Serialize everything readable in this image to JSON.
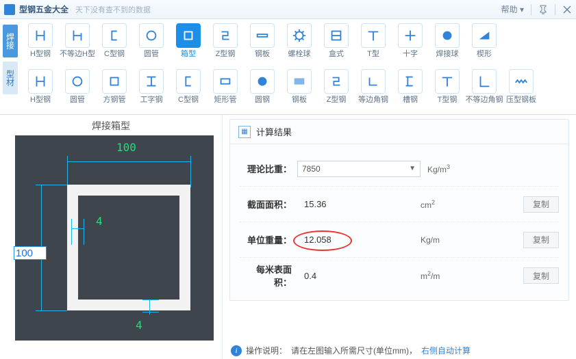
{
  "titlebar": {
    "title": "型钢五金大全",
    "subtitle": "天下没有查不到的数据",
    "help": "帮助",
    "help_arrow": "▾"
  },
  "side_tabs": {
    "weld": "焊接",
    "profile": "型材"
  },
  "row1": [
    {
      "name": "h-steel",
      "label": "H型钢"
    },
    {
      "name": "uneq-h",
      "label": "不等边H型"
    },
    {
      "name": "c-steel",
      "label": "C型钢"
    },
    {
      "name": "round-tube",
      "label": "圆管"
    },
    {
      "name": "box",
      "label": "箱型",
      "selected": true
    },
    {
      "name": "z-steel",
      "label": "Z型钢"
    },
    {
      "name": "plate",
      "label": "钢板"
    },
    {
      "name": "bolt-ball",
      "label": "螺栓球"
    },
    {
      "name": "box-style",
      "label": "盒式"
    },
    {
      "name": "t-type",
      "label": "T型"
    },
    {
      "name": "cross",
      "label": "十字"
    },
    {
      "name": "weld-ball",
      "label": "焊接球"
    },
    {
      "name": "wedge",
      "label": "楔形"
    }
  ],
  "row2": [
    {
      "name": "h-steel2",
      "label": "H型钢"
    },
    {
      "name": "round-tube2",
      "label": "圆管"
    },
    {
      "name": "sq-tube",
      "label": "方钢管"
    },
    {
      "name": "i-steel",
      "label": "工字钢"
    },
    {
      "name": "c-steel2",
      "label": "C型钢"
    },
    {
      "name": "rect-tube",
      "label": "矩形管"
    },
    {
      "name": "round-steel",
      "label": "圆钢"
    },
    {
      "name": "plate2",
      "label": "钢板"
    },
    {
      "name": "z-steel2",
      "label": "Z型钢"
    },
    {
      "name": "eq-angle",
      "label": "等边角钢"
    },
    {
      "name": "channel",
      "label": "槽钢"
    },
    {
      "name": "t-steel",
      "label": "T型钢"
    },
    {
      "name": "uneq-angle",
      "label": "不等边角钢"
    },
    {
      "name": "press-plate",
      "label": "压型钢板"
    }
  ],
  "left_title": "焊接箱型",
  "diagram": {
    "top": "100",
    "left": "100",
    "thick1": "4",
    "thick2": "4"
  },
  "panel": {
    "title": "计算结果",
    "rows": {
      "density": {
        "label": "理论比重：",
        "value": "7850",
        "unit": "Kg/m",
        "sup": "3"
      },
      "area": {
        "label": "截面面积：",
        "value": "15.36",
        "unit": "cm",
        "sup": "2",
        "btn": "复制"
      },
      "unit_weight": {
        "label": "单位重量：",
        "value": "12.058",
        "unit": "Kg/m",
        "btn": "复制"
      },
      "surface": {
        "label": "每米表面积：",
        "value": "0.4",
        "unit": "m",
        "sup": "2",
        "unit_suffix": "/m",
        "btn": "复制"
      }
    }
  },
  "hint": {
    "label": "操作说明：",
    "text": "请在左图输入所需尺寸(单位mm)，",
    "tail": "右侧自动计算"
  }
}
